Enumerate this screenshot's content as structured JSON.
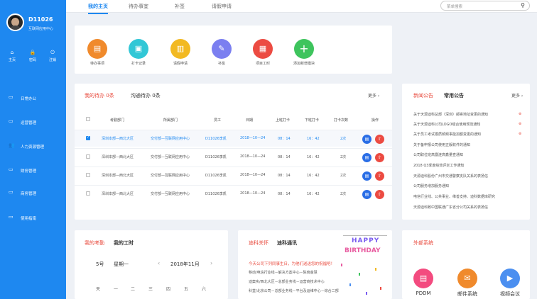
{
  "user": {
    "id": "D11026",
    "dept": "互联网应用中心"
  },
  "top_nav": [
    {
      "icon": "⌂",
      "label": "主页"
    },
    {
      "icon": "🔒",
      "label": "密码"
    },
    {
      "icon": "⏻",
      "label": "注销"
    }
  ],
  "side_menu": [
    {
      "icon": "▭",
      "label": "日常办公"
    },
    {
      "icon": "▭",
      "label": "运营管理"
    },
    {
      "icon": "👥",
      "label": "人力资源管理"
    },
    {
      "icon": "▭",
      "label": "财务管理"
    },
    {
      "icon": "▭",
      "label": "商务管理"
    },
    {
      "icon": "▭",
      "label": "使用指南"
    }
  ],
  "header": {
    "tabs": [
      "我的主页",
      "待办事宜",
      "补签",
      "请假申请"
    ],
    "search_placeholder": "菜单搜索",
    "search_icon": "search-icon"
  },
  "quick": [
    {
      "label": "待办事项",
      "color": "#f08a2c",
      "icon": "▤"
    },
    {
      "label": "打卡记录",
      "color": "#32c7d6",
      "icon": "▣"
    },
    {
      "label": "请假申请",
      "color": "#f2b922",
      "icon": "▥"
    },
    {
      "label": "补签",
      "color": "#7b7ff0",
      "icon": "✎"
    },
    {
      "label": "项目工时",
      "color": "#ec4b42",
      "icon": "▦"
    },
    {
      "label": "添加新增模块",
      "color": "#3ec45d",
      "icon": "+"
    }
  ],
  "todo": {
    "tab1": "我的待办",
    "tab1_count": "0条",
    "tab2": "沟通待办",
    "tab2_count": "0条",
    "more": "更多 ›",
    "columns": [
      "考勤部门",
      "所属部门",
      "员工",
      "日期",
      "上班打卡",
      "下班打卡",
      "打卡次数",
      "操作"
    ],
    "rows": [
      {
        "checked": true,
        "cols": [
          "深圳本部—西北大区",
          "交付部—互联网应用中心",
          "D11026李凯",
          "2018—10—24",
          "08：14",
          "16：42",
          "2次"
        ]
      },
      {
        "checked": false,
        "cols": [
          "深圳本部—西北大区",
          "交付部—互联网应用中心",
          "D11026李凯",
          "2018—10—24",
          "08：14",
          "16：42",
          "2次"
        ]
      },
      {
        "checked": false,
        "cols": [
          "深圳本部—西北大区",
          "交付部—互联网应用中心",
          "D11026李凯",
          "2018—10—24",
          "08：14",
          "16：42",
          "2次"
        ]
      },
      {
        "checked": false,
        "cols": [
          "深圳本部—西北大区",
          "交付部—互联网应用中心",
          "D11026李凯",
          "2018—10—24",
          "08：14",
          "16：42",
          "2次"
        ]
      }
    ]
  },
  "notices": {
    "tab1": "新闻公告",
    "tab2": "常用公告",
    "more": "更多 ›",
    "items": [
      "关于天源迪科总部（深圳）邮寄地址变更的通知",
      "关于天源迪科公司LOGO组合使用规范通知",
      "关于员工考试模质频频事能加额变更的通知",
      "关于备申报公司使用正版软件的通知",
      "公司职位班高露连高鑫量查通知",
      "2018 Q3季度绩效评定工作通知",
      "天源迪科股份广州市交通警察支队关系的表扬信",
      "公司服务增加服务通知",
      "电信行业线、公共事业、维善支持、迪科数据库研究",
      "天源迪科致中国联通广东省分公司关系的表扬信"
    ]
  },
  "attendance": {
    "tab1": "我的考勤",
    "tab2": "我的工时",
    "day": "5号",
    "weekday": "星期一",
    "month": "2018年11月",
    "week_labels": [
      "天",
      "一",
      "二",
      "三",
      "四",
      "五",
      "六"
    ]
  },
  "news": {
    "tab1": "迪科关怀",
    "tab2": "迪科通讯",
    "headline": "今天公司下列同事生日，为他们送送您的祝福吧！",
    "lines": [
      "移动/电信行业线－解决方案中心－陈晓金慧",
      "迪案实/西北大区－总部业务线－运营商技术中心",
      "科堂/北京公司－总部业务线－平台及运维中心－综合二部"
    ],
    "banner_top": "HAPPY",
    "banner_bottom": "BIRTHDAY"
  },
  "external": {
    "title": "外部系统",
    "items": [
      {
        "label": "PDDM",
        "color": "#f34b7f",
        "icon": "▤"
      },
      {
        "label": "邮件系统",
        "color": "#f08a2c",
        "icon": "✉"
      },
      {
        "label": "视频会议",
        "color": "#4b8ff0",
        "icon": "▶"
      }
    ]
  }
}
